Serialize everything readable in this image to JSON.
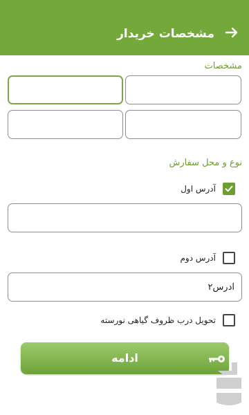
{
  "header": {
    "title": "مشخصات خریدار",
    "back_icon": "arrow-right-icon",
    "color": "#72a93a"
  },
  "details": {
    "label": "مشخصات",
    "fields": [
      {
        "value": "",
        "placeholder": ""
      },
      {
        "value": "",
        "placeholder": ""
      },
      {
        "value": "",
        "placeholder": ""
      },
      {
        "value": "",
        "placeholder": ""
      }
    ]
  },
  "order": {
    "label": "نوع و محل سفارش",
    "address1": {
      "label": "آدرس اول",
      "checked": true,
      "value": ""
    },
    "address2": {
      "label": "آدرس دوم",
      "checked": false,
      "value": "آدرس۲"
    },
    "plant_pot": {
      "label": "تحویل درب ظروف گیاهی نورسته",
      "checked": false
    }
  },
  "continue": {
    "label": "ادامه",
    "icon": "key-icon"
  },
  "accent_color": "#6c9e32",
  "watermark_icon": "app-store-logo-icon"
}
